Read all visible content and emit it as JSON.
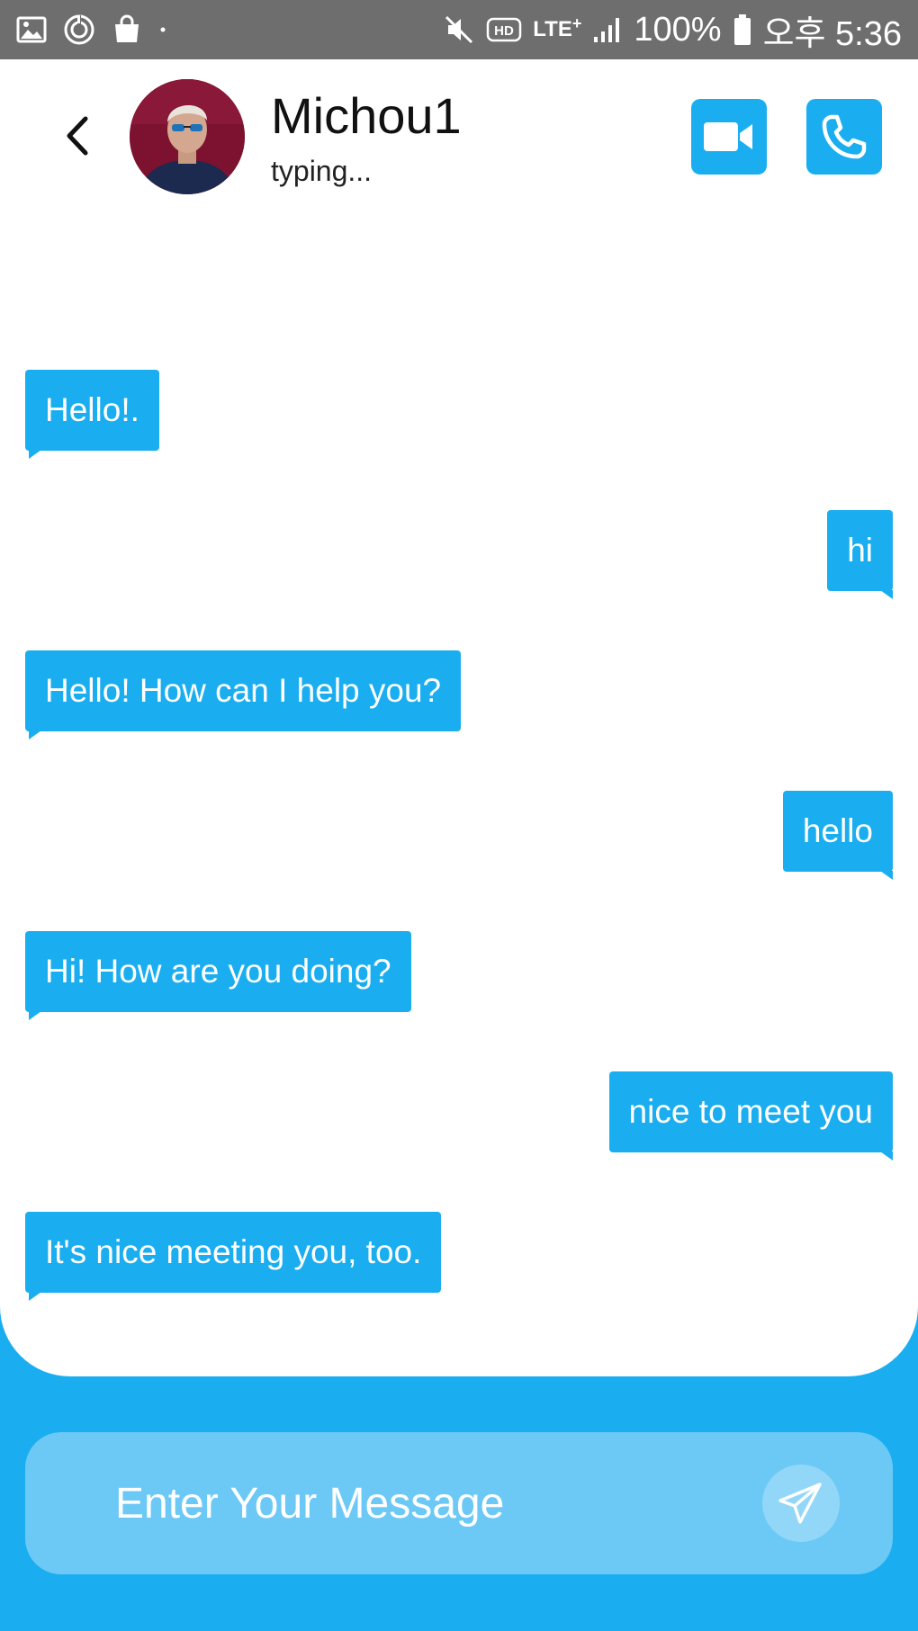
{
  "status_bar": {
    "network": "LTE",
    "network_super": "+",
    "battery": "100%",
    "time": "오후 5:36",
    "icons": [
      "gallery-icon",
      "sync-icon",
      "bag-icon",
      "dot-icon",
      "mute-icon",
      "hd-icon",
      "signal-icon",
      "battery-icon"
    ]
  },
  "header": {
    "back_icon": "chevron-left-icon",
    "contact_name": "Michou1",
    "contact_status": "typing...",
    "video_icon": "video-camera-icon",
    "call_icon": "phone-icon"
  },
  "messages": [
    {
      "direction": "incoming",
      "text": "Hello!."
    },
    {
      "direction": "outgoing",
      "text": "hi"
    },
    {
      "direction": "incoming",
      "text": "Hello! How can I help you?"
    },
    {
      "direction": "outgoing",
      "text": "hello"
    },
    {
      "direction": "incoming",
      "text": "Hi! How are you doing?"
    },
    {
      "direction": "outgoing",
      "text": "nice to meet you"
    },
    {
      "direction": "incoming",
      "text": "It's nice meeting you, too."
    }
  ],
  "composer": {
    "placeholder": "Enter Your Message",
    "value": "",
    "send_icon": "paper-plane-icon"
  },
  "colors": {
    "accent": "#1aaef0",
    "status_bar": "#6e6e6e",
    "input_bg": "#6cc9f5"
  }
}
